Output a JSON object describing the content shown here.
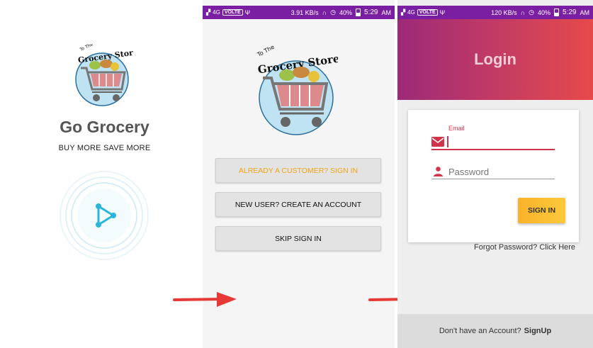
{
  "splash": {
    "app_name": "Go Grocery",
    "tagline": "BUY MORE SAVE MORE",
    "logo_text_top": "To The",
    "logo_text_main": "Grocery Store",
    "accent_color": "#29b6d8"
  },
  "status_bar": {
    "network": "4G",
    "volte": "VOLTE",
    "welcome_speed": "3.91 KB/s",
    "login_speed": "120 KB/s",
    "battery": "40%",
    "time": "5:29",
    "ampm": "AM",
    "color": "#7b1fa2"
  },
  "welcome": {
    "signin_label": "ALREADY A CUSTOMER? SIGN IN",
    "create_label": "NEW USER? CREATE AN ACCOUNT",
    "skip_label": "SKIP SIGN IN",
    "signin_color": "#f2a516"
  },
  "login": {
    "title": "Login",
    "email_label": "Email",
    "email_value": "",
    "password_placeholder": "Password",
    "signin_button": "SIGN IN",
    "forgot_password": "Forgot Password? Click Here",
    "no_account_text": "Don't have an Account?",
    "signup_link": "SignUp",
    "accent_color": "#d0334a",
    "button_color": "#f9b22a"
  }
}
